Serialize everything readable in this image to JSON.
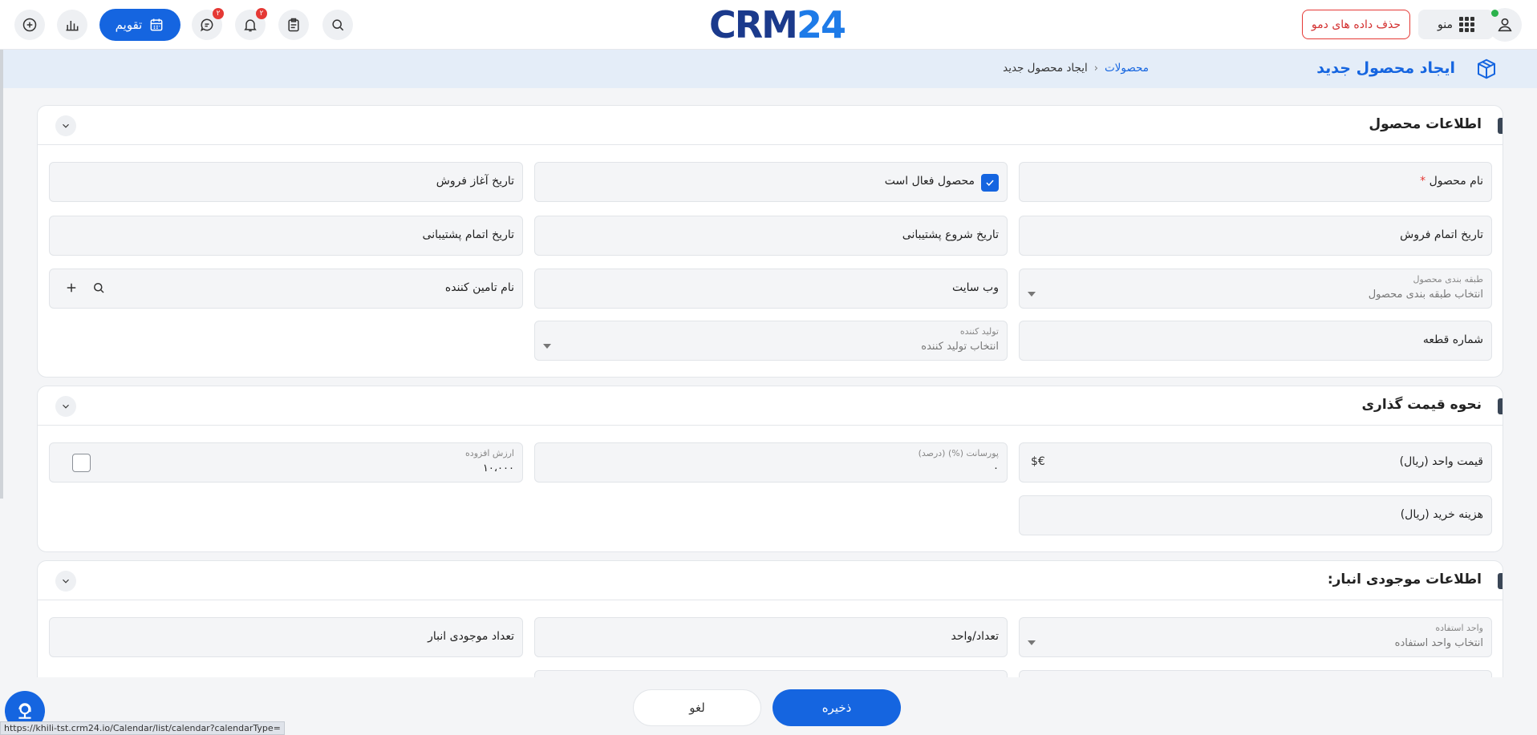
{
  "topbar": {
    "calendar_label": "تقویم",
    "chat_badge": "۲",
    "notif_badge": "۲",
    "logo_dark": "CRM",
    "logo_light": "24",
    "delete_demo_label": "حذف داده های دمو",
    "menu_label": "منو"
  },
  "page": {
    "title": "ایجاد محصول جدید",
    "breadcrumb": {
      "link": "محصولات",
      "current": "ایجاد محصول جدید"
    }
  },
  "sections": {
    "product_info": {
      "title": "اطلاعات محصول",
      "product_name": "نام محصول",
      "required_mark": "*",
      "active_label": "محصول فعال است",
      "sale_start": "تاریخ آغاز فروش",
      "sale_end": "تاریخ اتمام فروش",
      "support_start": "تاریخ شروع پشتیبانی",
      "support_end": "تاریخ اتمام پشتیبانی",
      "category_label": "طبقه بندی محصول",
      "category_placeholder": "انتخاب طبقه بندی محصول",
      "website": "وب سایت",
      "supplier": "نام تامین کننده",
      "part_number": "شماره قطعه",
      "manufacturer_label": "تولید کننده",
      "manufacturer_placeholder": "انتخاب تولید کننده"
    },
    "pricing": {
      "title": "نحوه قیمت گذاری",
      "unit_price": "قیمت واحد (ریال)",
      "currency_symbol": "$€",
      "commission_label": "پورسانت (%) (درصد)",
      "commission_value": "۰",
      "vat_label": "ارزش افزوده",
      "vat_value": "۱۰،۰۰۰",
      "purchase_cost": "هزینه خرید (ریال)"
    },
    "inventory": {
      "title": "اطلاعات موجودی انبار:",
      "usage_unit_label": "واحد استفاده",
      "usage_unit_placeholder": "انتخاب واحد استفاده",
      "qty_per_unit": "تعداد/واحد",
      "stock_qty": "تعداد موجودی انبار"
    }
  },
  "footer": {
    "cancel_label": "لغو",
    "save_label": "ذخیره"
  },
  "status_url": "https://khili-tst.crm24.io/Calendar/list/calendar?calendarType="
}
